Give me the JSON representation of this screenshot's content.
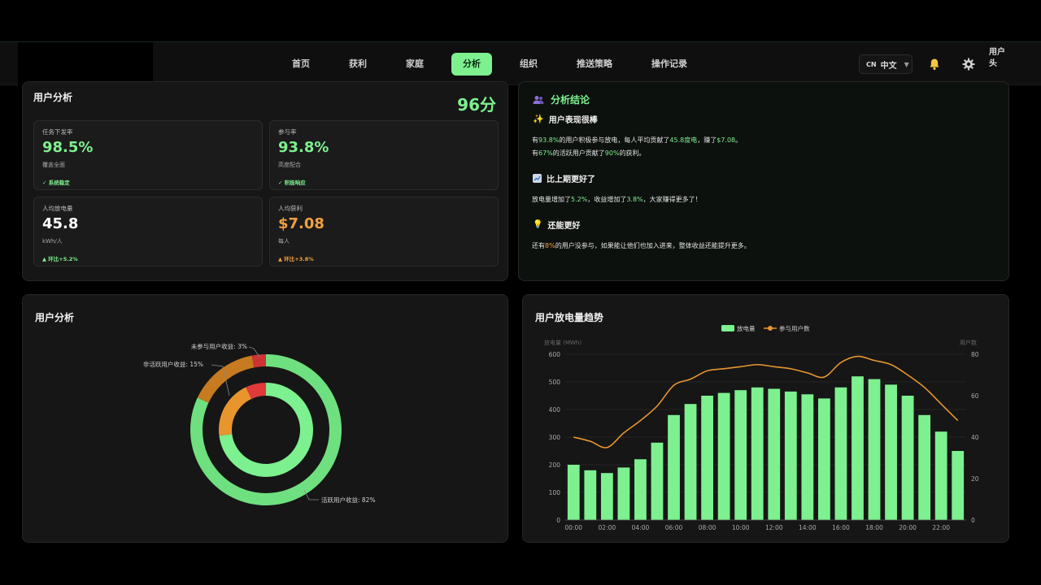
{
  "nav": {
    "items": [
      "首页",
      "获利",
      "家庭",
      "分析",
      "组织",
      "推送策略",
      "操作记录"
    ],
    "active_index": 3,
    "lang_flag": "CN",
    "lang_label": "中文",
    "avatar_alt": "用户头"
  },
  "overview": {
    "title": "用户分析",
    "score": "96分",
    "metrics": [
      {
        "label": "任务下发率",
        "value": "98.5%",
        "sub": "覆盖全面",
        "note": "✓ 系统稳定",
        "color": "#7df08f"
      },
      {
        "label": "参与率",
        "value": "93.8%",
        "sub": "高度配合",
        "note": "✓ 积极响应",
        "color": "#7df08f"
      },
      {
        "label": "人均放电量",
        "value": "45.8",
        "sub": "kWh/人",
        "note": "▲ 环比+5.2%",
        "color": "#ffffff",
        "note_color": "#7df08f"
      },
      {
        "label": "人均获利",
        "value": "$7.08",
        "sub": "每人",
        "note": "▲ 环比+3.8%",
        "color": "#f0a040",
        "note_color": "#f0a040"
      }
    ]
  },
  "conclusion": {
    "title": "分析结论",
    "s1_title": "用户表现很棒",
    "s1_l1": [
      "有",
      "93.8%",
      "的用户积极参与放电，每人平均贡献了",
      "45.8度电",
      "，赚了",
      "$7.08",
      "。"
    ],
    "s1_l2": [
      "有",
      "67%",
      "的活跃用户贡献了",
      "90%",
      "的获利。"
    ],
    "s2_title": "比上期更好了",
    "s2_l1": [
      "放电量增加了",
      "5.2%",
      "，收益增加了",
      "3.8%",
      "，大家赚得更多了！"
    ],
    "s3_title": "还能更好",
    "s3_l1": [
      "还有",
      "8%",
      "的用户没参与，如果能让他们也加入进来，整体收益还能提升更多。"
    ]
  },
  "donut": {
    "title": "用户分析",
    "labels": {
      "inactive": "非活跃用户收益: 15%",
      "nonpart": "未参与用户收益: 3%",
      "active": "活跃用户收益: 82%"
    }
  },
  "trend": {
    "title": "用户放电量趋势",
    "legend_bar": "放电量",
    "legend_line": "参与用户数",
    "ylabel_left": "放电量 (MWh)",
    "ylabel_right": "用户数"
  },
  "chart_data": [
    {
      "type": "pie",
      "title": "用户分析",
      "slices": [
        {
          "name": "活跃用户收益",
          "value": 82,
          "color": "#6fe07f"
        },
        {
          "name": "非活跃用户收益",
          "value": 15,
          "color": "#c77a1f"
        },
        {
          "name": "未参与用户收益",
          "value": 3,
          "color": "#c33"
        }
      ],
      "inner_ring": [
        {
          "name": "活跃用户收益",
          "value": 73,
          "color": "#7df08f"
        },
        {
          "name": "非活跃用户收益",
          "value": 20,
          "color": "#e8952e"
        },
        {
          "name": "未参与用户收益",
          "value": 7,
          "color": "#e03a3a"
        }
      ]
    },
    {
      "type": "bar",
      "title": "用户放电量趋势",
      "categories": [
        "00:00",
        "01:00",
        "02:00",
        "03:00",
        "04:00",
        "05:00",
        "06:00",
        "07:00",
        "08:00",
        "09:00",
        "10:00",
        "11:00",
        "12:00",
        "13:00",
        "14:00",
        "15:00",
        "16:00",
        "17:00",
        "18:00",
        "19:00",
        "20:00",
        "21:00",
        "22:00",
        "23:00"
      ],
      "x_tick_labels": [
        "00:00",
        "02:00",
        "04:00",
        "06:00",
        "08:00",
        "10:00",
        "12:00",
        "14:00",
        "16:00",
        "18:00",
        "20:00",
        "22:00"
      ],
      "series": [
        {
          "name": "放电量",
          "type": "bar",
          "axis": "left",
          "color": "#7df08f",
          "values": [
            200,
            180,
            170,
            190,
            220,
            280,
            380,
            420,
            450,
            460,
            470,
            480,
            475,
            465,
            455,
            440,
            480,
            520,
            510,
            490,
            450,
            380,
            320,
            250
          ]
        },
        {
          "name": "参与用户数",
          "type": "line",
          "axis": "right",
          "color": "#e8952e",
          "values": [
            40,
            38,
            35,
            42,
            48,
            55,
            65,
            68,
            72,
            73,
            74,
            75,
            74,
            73,
            71,
            69,
            76,
            79,
            77,
            75,
            70,
            64,
            56,
            48
          ]
        }
      ],
      "ylim_left": [
        0,
        600
      ],
      "yticks_left": [
        0,
        100,
        200,
        300,
        400,
        500,
        600
      ],
      "ylim_right": [
        0,
        80
      ],
      "yticks_right": [
        0,
        20,
        40,
        60,
        80
      ],
      "grid": true,
      "legend_position": "top-center"
    }
  ]
}
